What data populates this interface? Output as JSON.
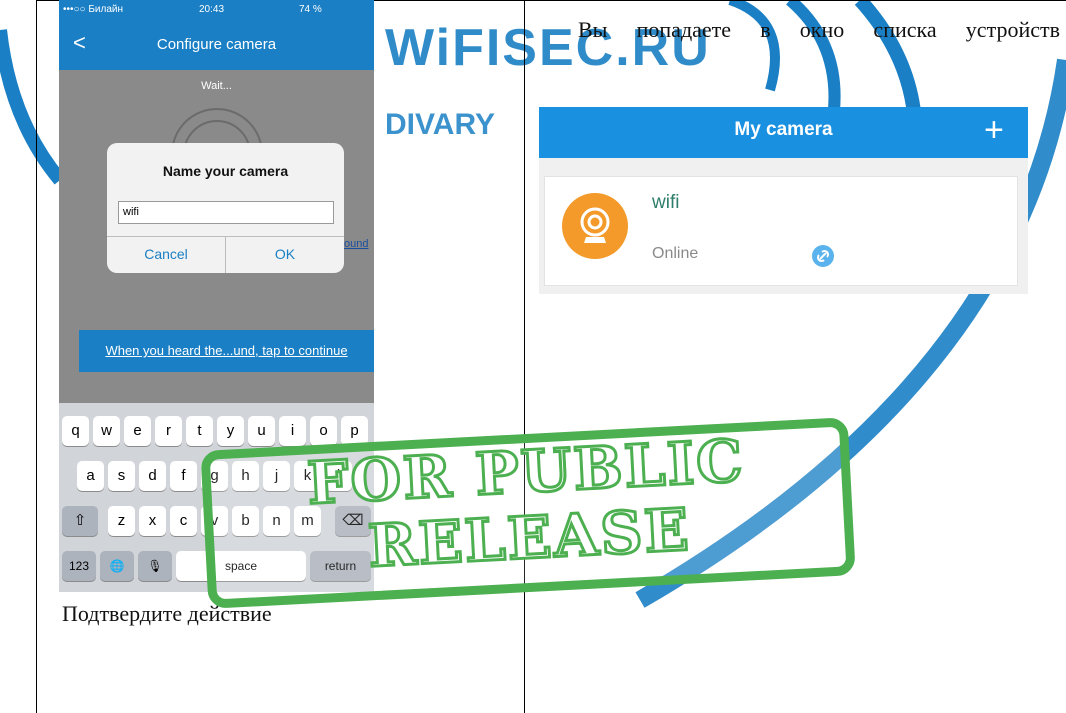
{
  "watermark": {
    "brand": "WiFISEC.RU",
    "sub": "DIVARY",
    "stamp_line1": "FOR PUBLIC",
    "stamp_line2": "RELEASE",
    "stamp_color": "#4caf50"
  },
  "left_cell": {
    "caption": "Подтвердите действие",
    "phone": {
      "status": {
        "carrier": "•••○○ Билайн",
        "time": "20:43",
        "battery": "74 %"
      },
      "nav": {
        "back": "<",
        "title": "Configure camera"
      },
      "wait_text": "Wait...",
      "side_link": "ound",
      "continue_label": "When you heard the...und, tap to continue",
      "dialog": {
        "title": "Name your camera",
        "input_value": "wifi",
        "cancel": "Cancel",
        "ok": "OK"
      },
      "keyboard": {
        "row1": [
          "q",
          "w",
          "e",
          "r",
          "t",
          "y",
          "u",
          "i",
          "o",
          "p"
        ],
        "row2": [
          "a",
          "s",
          "d",
          "f",
          "g",
          "h",
          "j",
          "k",
          "l"
        ],
        "row3": [
          "z",
          "x",
          "c",
          "v",
          "b",
          "n",
          "m"
        ],
        "shift": "⇧",
        "delete": "⌫",
        "numbers": "123",
        "globe": "🌐",
        "mic": "🎙",
        "space": "space",
        "return": "return"
      }
    }
  },
  "right_cell": {
    "description": "Вы попадаете в окно списка устройств",
    "app": {
      "title": "My camera",
      "add": "+",
      "camera_name": "wifi",
      "camera_status": "Online",
      "header_color": "#1a90e0",
      "avatar_color": "#f39a2a"
    }
  }
}
